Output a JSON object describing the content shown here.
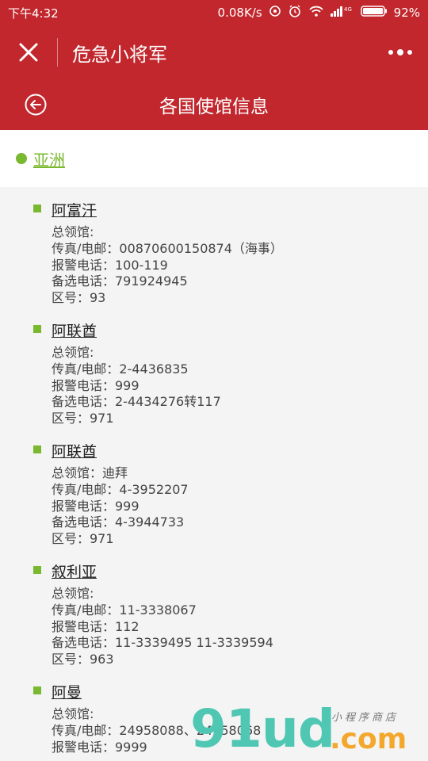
{
  "status": {
    "time": "下午4:32",
    "speed": "0.08K/s",
    "battery": "92%",
    "signal_label": "4G"
  },
  "navbar": {
    "title": "危急小将军"
  },
  "subheader": {
    "title": "各国使馆信息"
  },
  "region": {
    "label": "亚洲"
  },
  "entries": [
    {
      "country": "阿富汗",
      "consulate": "总领馆:",
      "fax": "传真/电邮：00870600150874（海事）",
      "police": "报警电话：100-119",
      "alt": "备选电话：791924945",
      "area": "区号：93"
    },
    {
      "country": "阿联酋",
      "consulate": "总领馆:",
      "fax": "传真/电邮：2-4436835",
      "police": "报警电话：999",
      "alt": "备选电话：2-4434276转117",
      "area": "区号：971"
    },
    {
      "country": "阿联酋",
      "consulate": "总领馆：迪拜",
      "fax": "传真/电邮：4-3952207",
      "police": "报警电话：999",
      "alt": "备选电话：4-3944733",
      "area": "区号：971"
    },
    {
      "country": "叙利亚",
      "consulate": "总领馆:",
      "fax": "传真/电邮：11-3338067",
      "police": "报警电话：112",
      "alt": "备选电话：11-3339495 11-3339594",
      "area": "区号：963"
    },
    {
      "country": "阿曼",
      "consulate": "总领馆:",
      "fax": "传真/电邮：24958088、24958068",
      "police": "报警电话：9999",
      "alt": "",
      "area": ""
    }
  ],
  "watermark": {
    "main": "91ud",
    "com": ".com",
    "small": "小程序商店"
  },
  "colors": {
    "primary": "#c1272d",
    "accent": "#7ab830",
    "background": "#f4f4f4"
  }
}
